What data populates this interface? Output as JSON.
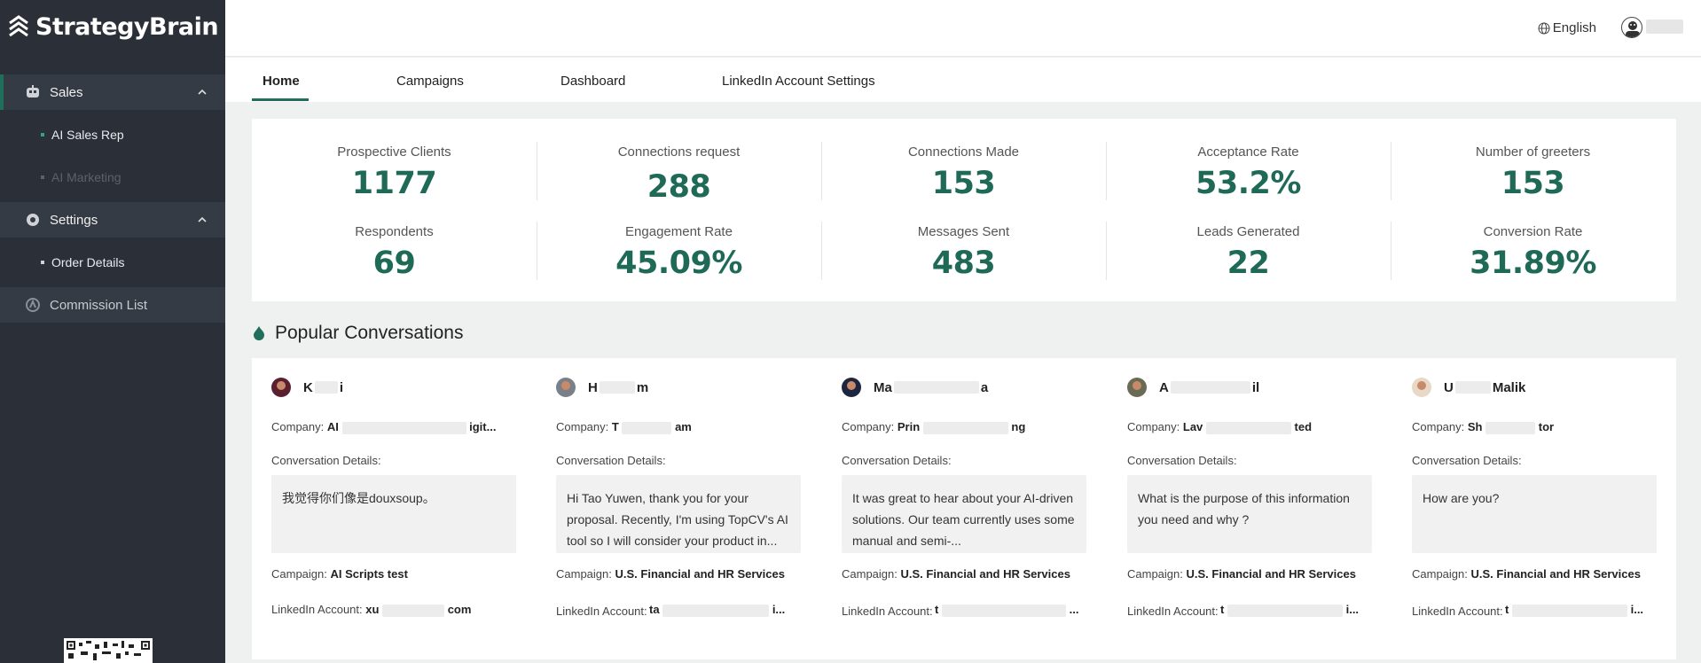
{
  "brand": {
    "name": "StrategyBrain"
  },
  "sidebar": {
    "groups": [
      {
        "label": "Sales",
        "icon": "robot-icon",
        "expanded": true
      },
      {
        "label": "Settings",
        "icon": "gear-icon",
        "expanded": true
      },
      {
        "label": "Commission List",
        "icon": "commission-icon"
      }
    ],
    "items": [
      {
        "label": "AI Sales Rep"
      },
      {
        "label": "AI Marketing"
      },
      {
        "label": "Order Details"
      }
    ]
  },
  "header": {
    "language": "English"
  },
  "tabs": [
    {
      "label": "Home",
      "active": true
    },
    {
      "label": "Campaigns"
    },
    {
      "label": "Dashboard"
    },
    {
      "label": "LinkedIn Account Settings"
    }
  ],
  "stats": [
    {
      "label": "Prospective Clients",
      "value": "1177"
    },
    {
      "label": "Connections request",
      "value": "288"
    },
    {
      "label": "Connections Made",
      "value": "153"
    },
    {
      "label": "Acceptance Rate",
      "value": "53.2%"
    },
    {
      "label": "Number of greeters",
      "value": "153"
    },
    {
      "label": "Respondents",
      "value": "69"
    },
    {
      "label": "Engagement Rate",
      "value": "45.09%"
    },
    {
      "label": "Messages Sent",
      "value": "483"
    },
    {
      "label": "Leads Generated",
      "value": "22"
    },
    {
      "label": "Conversion Rate",
      "value": "31.89%"
    }
  ],
  "popular": {
    "title": "Popular Conversations",
    "company_label": "Company:",
    "details_label": "Conversation Details:",
    "campaign_label": "Campaign:",
    "linkedin_label": "LinkedIn Account:",
    "conversations": [
      {
        "name_start": "K",
        "name_end": "i",
        "company_start": "AI",
        "company_end": "igit...",
        "message": "我觉得你们像是douxsoup。",
        "campaign": "AI Scripts test",
        "account_start": "xu",
        "account_end": "com"
      },
      {
        "name_start": "H",
        "name_end": "m",
        "company_start": "T",
        "company_end": "am",
        "message": "Hi Tao Yuwen, thank you for your proposal. Recently, I'm using TopCV's AI tool so I will consider your product in...",
        "campaign": "U.S. Financial and HR Services",
        "account_start": "ta",
        "account_end": "i..."
      },
      {
        "name_start": "Ma",
        "name_end": "a",
        "company_start": "Prin",
        "company_end": "ng",
        "message": "It was great to hear about your AI-driven solutions. Our team currently uses some manual and semi-...",
        "campaign": "U.S. Financial and HR Services",
        "account_start": "t",
        "account_end": "..."
      },
      {
        "name_start": "A",
        "name_end": "il",
        "company_start": "Lav",
        "company_end": "ted",
        "message": "What is the purpose of this information you need and why ?",
        "campaign": "U.S. Financial and HR Services",
        "account_start": "t",
        "account_end": "i..."
      },
      {
        "name_start": "U",
        "name_end": "Malik",
        "company_start": "Sh",
        "company_end": "tor",
        "message": "How are you?",
        "campaign": "U.S. Financial and HR Services",
        "account_start": "t",
        "account_end": "i..."
      }
    ]
  }
}
